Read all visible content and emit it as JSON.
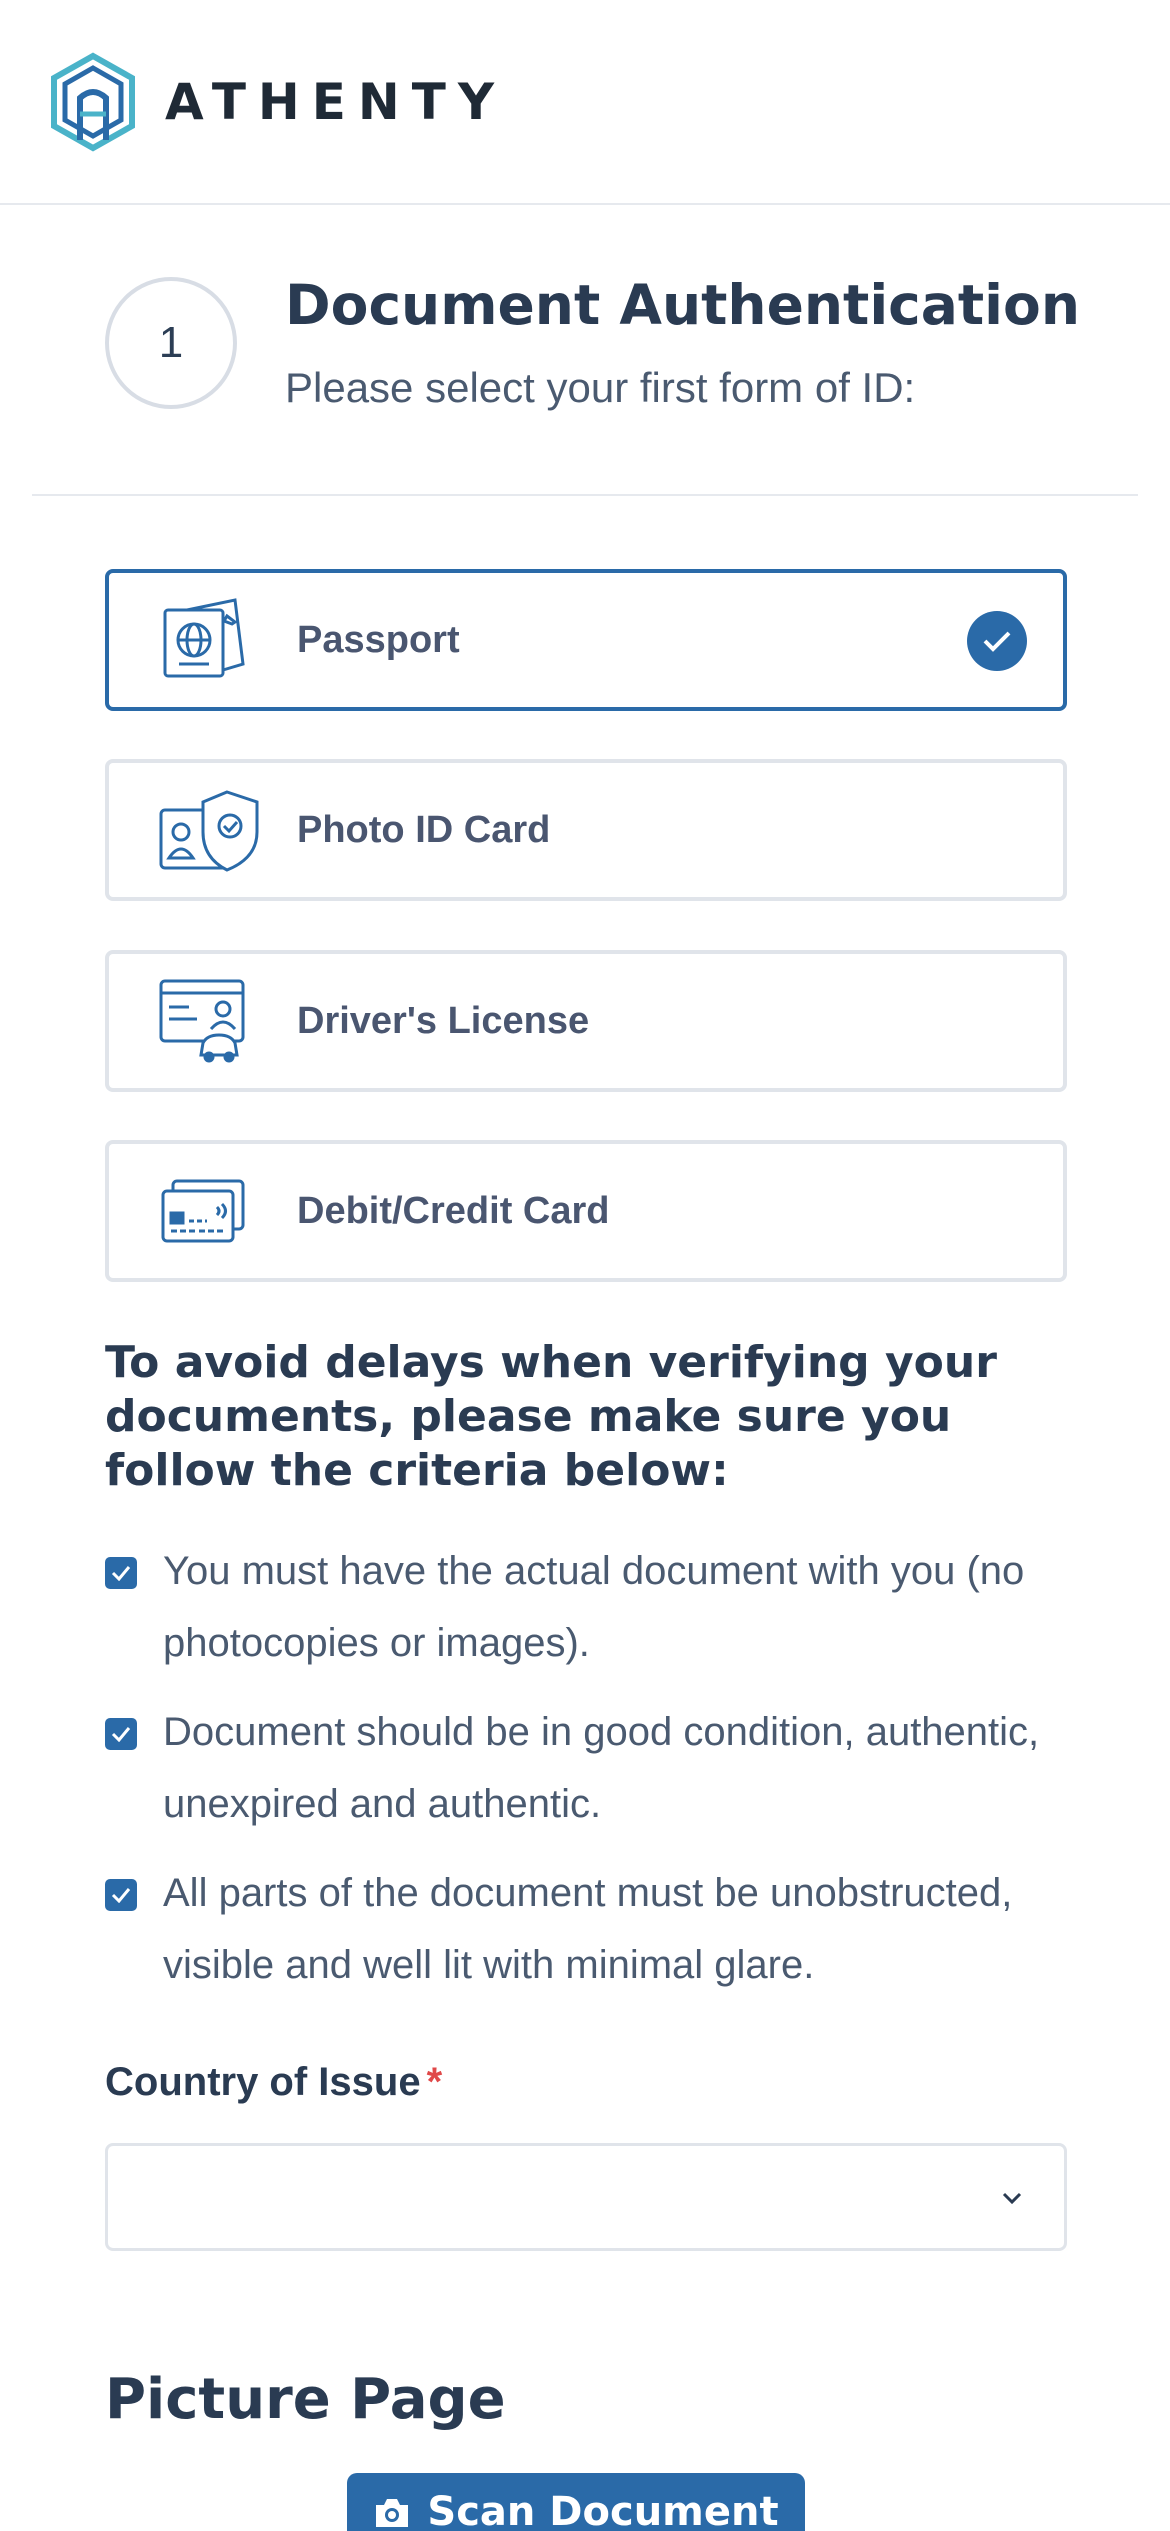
{
  "header": {
    "brand": "ATHENTY"
  },
  "step": {
    "number": "1",
    "title": "Document Authentication",
    "subtitle": "Please select your first form of ID:"
  },
  "options": [
    {
      "label": "Passport",
      "icon": "passport-icon",
      "selected": true
    },
    {
      "label": "Photo ID Card",
      "icon": "photo-id-card-icon",
      "selected": false
    },
    {
      "label": "Driver's License",
      "icon": "drivers-license-icon",
      "selected": false
    },
    {
      "label": "Debit/Credit Card",
      "icon": "credit-card-icon",
      "selected": false
    }
  ],
  "criteria": {
    "title": "To avoid delays when verifying your documents, please make sure you follow the criteria below:",
    "items": [
      "You must have the actual document with you (no photocopies or images).",
      "Document should be in good condition, authentic, unexpired and authentic.",
      "All parts of the document must be unobstructed, visible and well lit with minimal glare."
    ]
  },
  "country": {
    "label": "Country of Issue",
    "required_mark": "*",
    "value": ""
  },
  "picture_page": {
    "title": "Picture Page",
    "scan_button": "Scan Document"
  },
  "colors": {
    "accent": "#2a6aa8",
    "required": "#e04848",
    "border": "#e0e4ea",
    "heading": "#2a3b52"
  }
}
